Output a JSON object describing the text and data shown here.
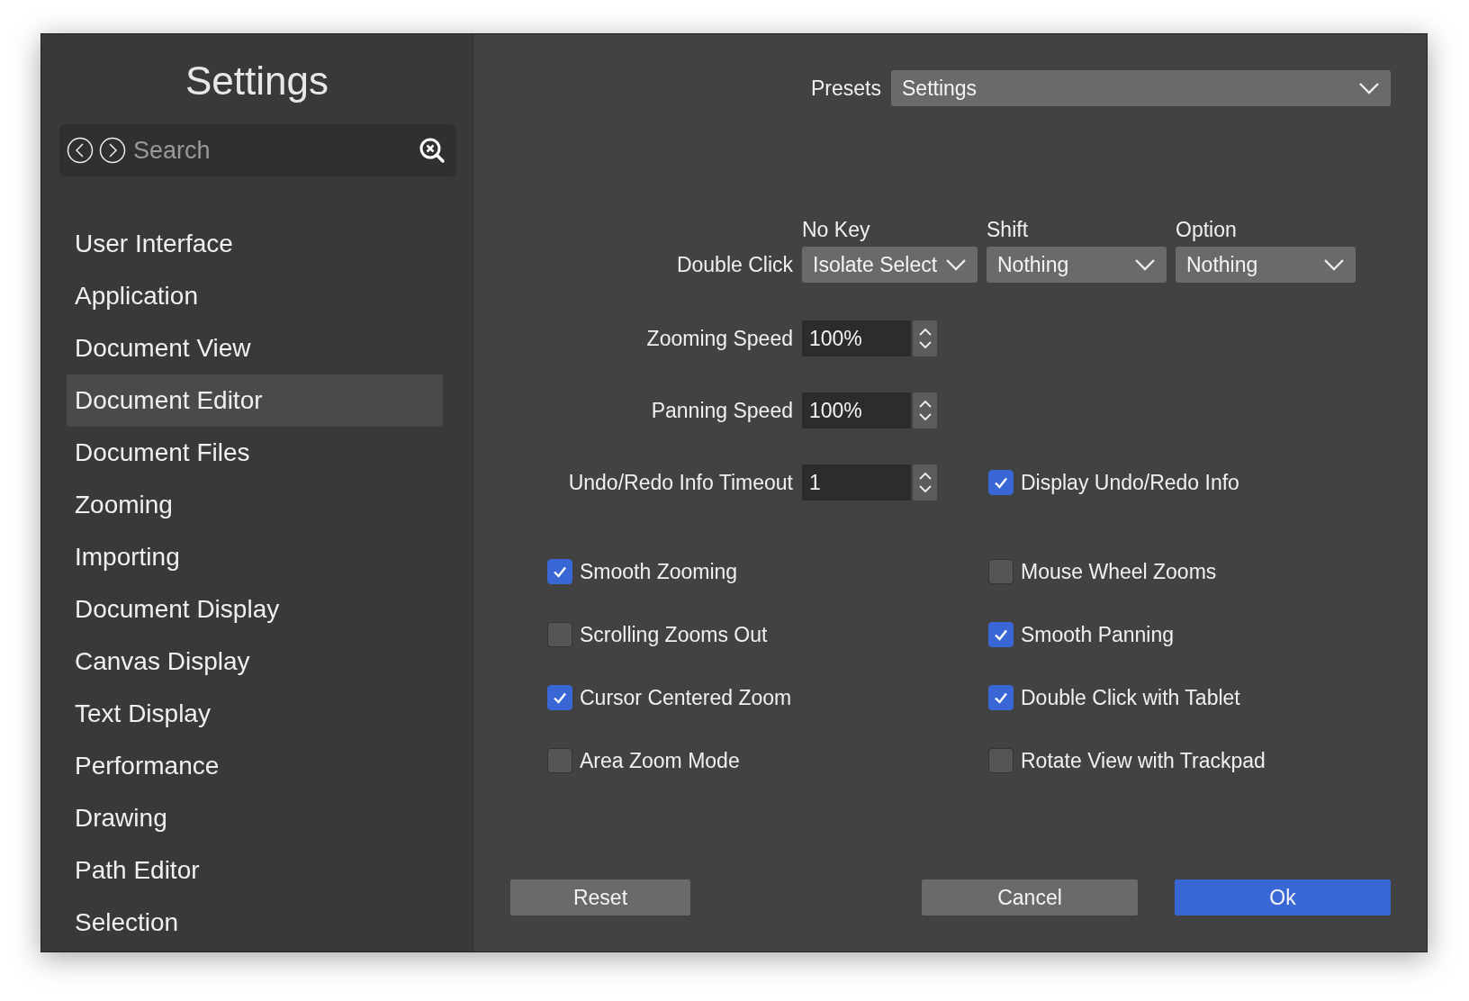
{
  "sidebar": {
    "title": "Settings",
    "search": {
      "placeholder": "Search"
    },
    "items": [
      {
        "label": "User Interface",
        "selected": false
      },
      {
        "label": "Application",
        "selected": false
      },
      {
        "label": "Document View",
        "selected": false
      },
      {
        "label": "Document Editor",
        "selected": true
      },
      {
        "label": "Document Files",
        "selected": false
      },
      {
        "label": "Zooming",
        "selected": false
      },
      {
        "label": "Importing",
        "selected": false
      },
      {
        "label": "Document Display",
        "selected": false
      },
      {
        "label": "Canvas Display",
        "selected": false
      },
      {
        "label": "Text Display",
        "selected": false
      },
      {
        "label": "Performance",
        "selected": false
      },
      {
        "label": "Drawing",
        "selected": false
      },
      {
        "label": "Path Editor",
        "selected": false
      },
      {
        "label": "Selection",
        "selected": false
      }
    ]
  },
  "presets": {
    "label": "Presets",
    "value": "Settings"
  },
  "modifier_columns": [
    "No Key",
    "Shift",
    "Option"
  ],
  "double_click": {
    "label": "Double Click",
    "values": [
      "Isolate Select",
      "Nothing",
      "Nothing"
    ]
  },
  "steppers": [
    {
      "label": "Zooming Speed",
      "value": "100%"
    },
    {
      "label": "Panning Speed",
      "value": "100%"
    },
    {
      "label": "Undo/Redo Info Timeout",
      "value": "1",
      "checkbox": {
        "label": "Display Undo/Redo Info",
        "checked": true
      }
    }
  ],
  "checkboxes": [
    {
      "label": "Smooth Zooming",
      "checked": true
    },
    {
      "label": "Mouse Wheel Zooms",
      "checked": false
    },
    {
      "label": "Scrolling Zooms Out",
      "checked": false
    },
    {
      "label": "Smooth Panning",
      "checked": true
    },
    {
      "label": "Cursor Centered Zoom",
      "checked": true
    },
    {
      "label": "Double Click with Tablet",
      "checked": true
    },
    {
      "label": "Area Zoom Mode",
      "checked": false
    },
    {
      "label": "Rotate View with Trackpad",
      "checked": false
    }
  ],
  "buttons": [
    {
      "label": "Reset",
      "kind": "plain"
    },
    {
      "label": "Cancel",
      "kind": "plain"
    },
    {
      "label": "Ok",
      "kind": "primary"
    }
  ]
}
